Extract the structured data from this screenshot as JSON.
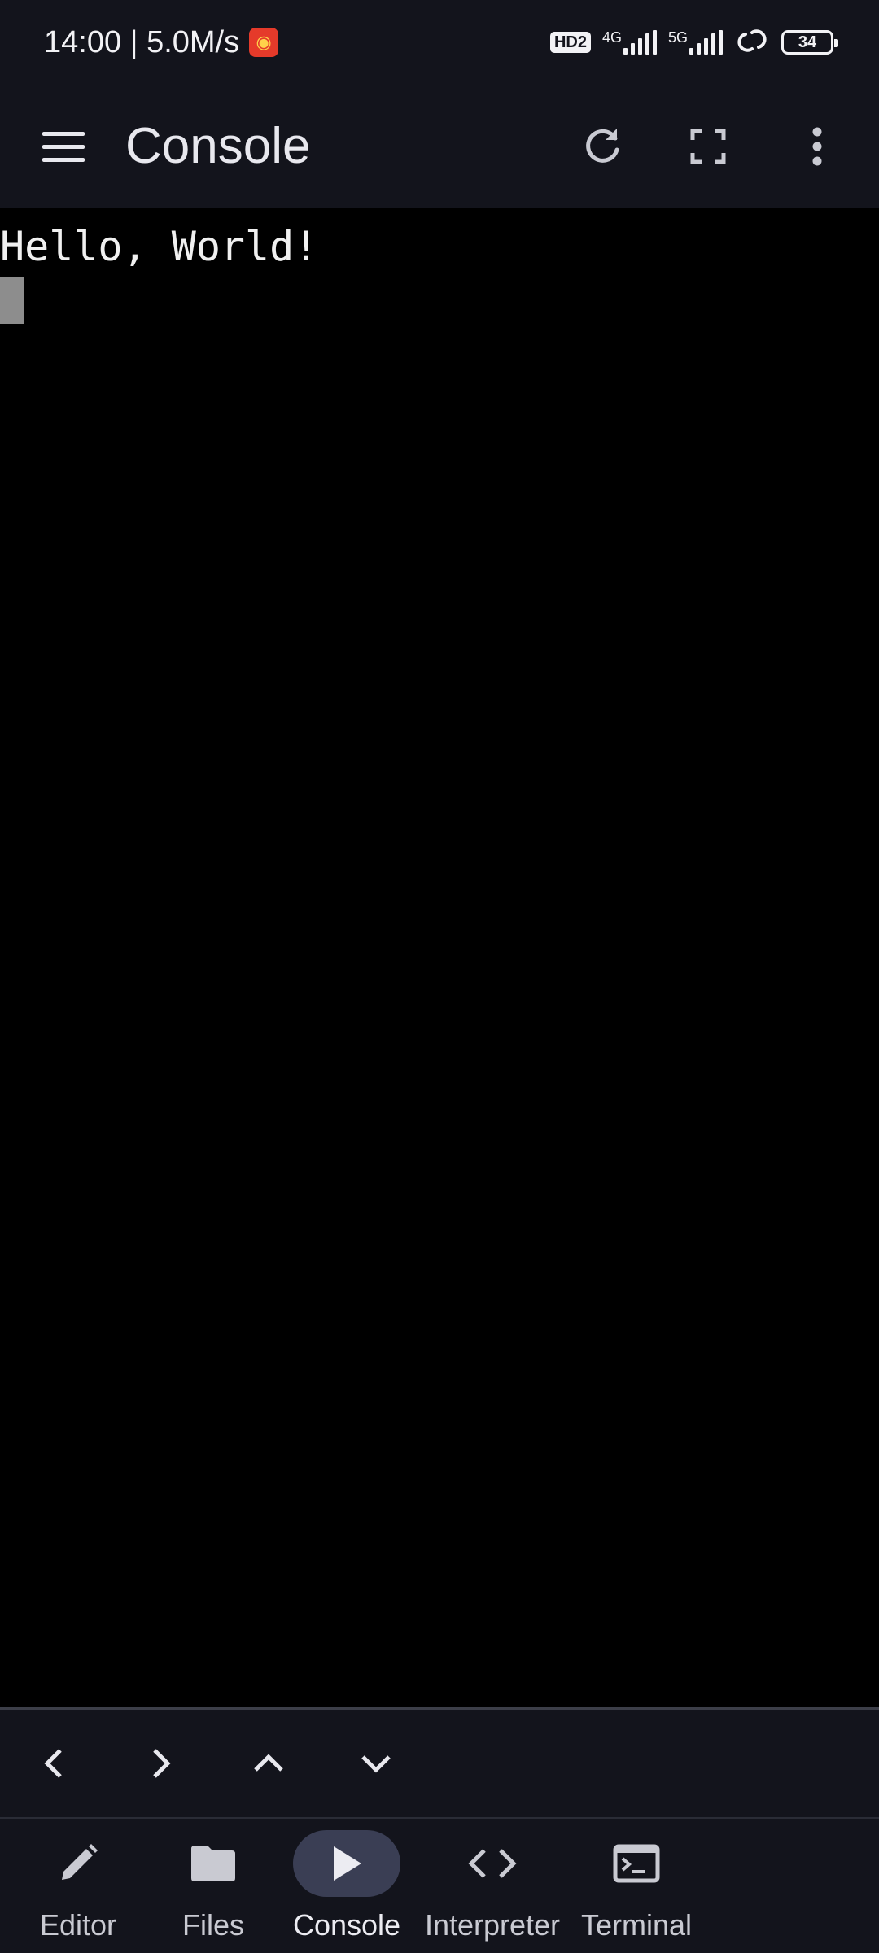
{
  "status_bar": {
    "time_speed": "14:00 | 5.0M/s",
    "hd_label": "HD2",
    "net1_label": "4G",
    "net2_label": "5G",
    "battery": "34"
  },
  "app_bar": {
    "title": "Console"
  },
  "console": {
    "lines": [
      "Hello, World!"
    ]
  },
  "bottom_nav": {
    "items": [
      {
        "label": "Editor",
        "icon": "pencil-icon"
      },
      {
        "label": "Files",
        "icon": "folder-icon"
      },
      {
        "label": "Console",
        "icon": "play-icon",
        "active": true
      },
      {
        "label": "Interpreter",
        "icon": "code-icon"
      },
      {
        "label": "Terminal",
        "icon": "terminal-icon"
      }
    ]
  },
  "colors": {
    "background": "#13141c",
    "console_bg": "#000000",
    "active_pill": "#3a3e54",
    "cursor": "#8d8d8d"
  }
}
